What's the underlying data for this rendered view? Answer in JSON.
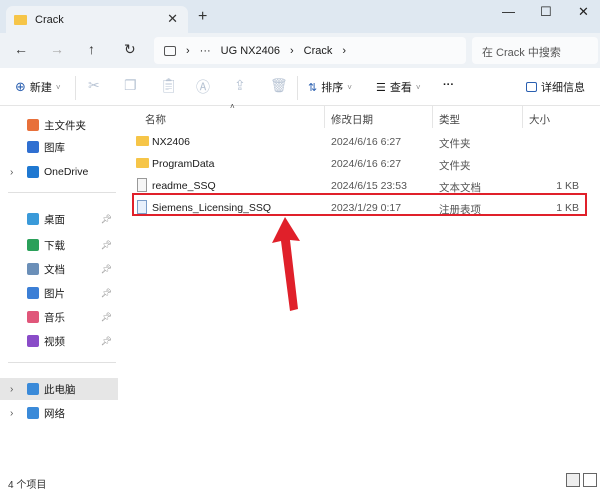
{
  "window": {
    "tab_title": "Crack",
    "new_tab": "+",
    "min": "—",
    "max": "☐",
    "close": "✕"
  },
  "nav": {
    "back": "←",
    "forward": "→",
    "up": "↑",
    "refresh": "↻",
    "breadcrumb": [
      "···",
      "UG NX2406",
      "Crack"
    ],
    "search_placeholder": "在 Crack 中搜索"
  },
  "toolbar": {
    "new": "新建",
    "sort": "排序",
    "view": "查看",
    "more": "···",
    "details": "详细信息"
  },
  "sidebar": {
    "items": [
      {
        "label": "主文件夹",
        "color": "#e8703a"
      },
      {
        "label": "图库",
        "color": "#2f6fd1"
      },
      {
        "label": "OneDrive",
        "color": "#1f78d1"
      },
      {
        "label": "桌面",
        "color": "#3a9ad9"
      },
      {
        "label": "下载",
        "color": "#2aa05a"
      },
      {
        "label": "文档",
        "color": "#6b8fb8"
      },
      {
        "label": "图片",
        "color": "#3c7fd6"
      },
      {
        "label": "音乐",
        "color": "#e0567a"
      },
      {
        "label": "视频",
        "color": "#8a4cc8"
      },
      {
        "label": "此电脑",
        "color": "#3a8ad9"
      },
      {
        "label": "网络",
        "color": "#3a8ad9"
      }
    ]
  },
  "columns": {
    "name": "名称",
    "date": "修改日期",
    "type": "类型",
    "size": "大小"
  },
  "files": [
    {
      "name": "NX2406",
      "date": "2024/6/16 6:27",
      "type": "文件夹",
      "size": "",
      "icon": "folder"
    },
    {
      "name": "ProgramData",
      "date": "2024/6/16 6:27",
      "type": "文件夹",
      "size": "",
      "icon": "folder"
    },
    {
      "name": "readme_SSQ",
      "date": "2024/6/15 23:53",
      "type": "文本文档",
      "size": "1 KB",
      "icon": "text"
    },
    {
      "name": "Siemens_Licensing_SSQ",
      "date": "2023/1/29 0:17",
      "type": "注册表项",
      "size": "1 KB",
      "icon": "registry"
    }
  ],
  "status": {
    "count": "4 个项目"
  },
  "highlight_color": "#e0202a"
}
